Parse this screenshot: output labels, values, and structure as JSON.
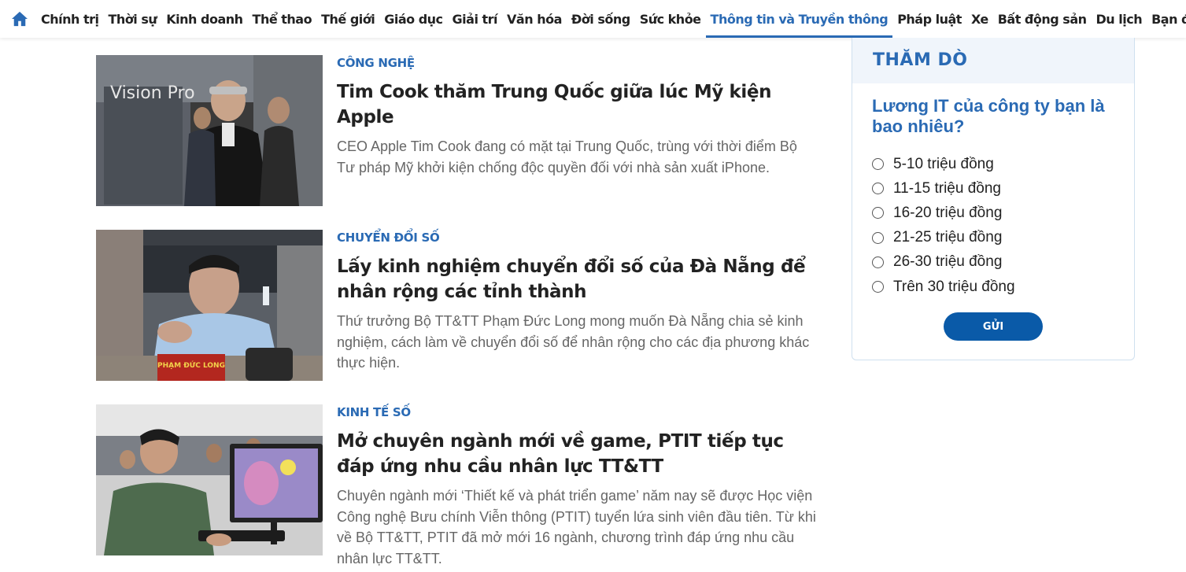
{
  "nav": {
    "home_icon": "home-icon",
    "items": [
      {
        "label": "Chính trị"
      },
      {
        "label": "Thời sự"
      },
      {
        "label": "Kinh doanh"
      },
      {
        "label": "Thể thao"
      },
      {
        "label": "Thế giới"
      },
      {
        "label": "Giáo dục"
      },
      {
        "label": "Giải trí"
      },
      {
        "label": "Văn hóa"
      },
      {
        "label": "Đời sống"
      },
      {
        "label": "Sức khỏe"
      },
      {
        "label": "Thông tin và Truyền thông",
        "active": true
      },
      {
        "label": "Pháp luật"
      },
      {
        "label": "Xe"
      },
      {
        "label": "Bất động sản"
      },
      {
        "label": "Du lịch"
      },
      {
        "label": "Bạn đọc"
      }
    ]
  },
  "articles": [
    {
      "category": "Công nghệ",
      "title": "Tim Cook thăm Trung Quốc giữa lúc Mỹ kiện Apple",
      "description": "CEO Apple Tim Cook đang có mặt tại Trung Quốc, trùng với thời điểm Bộ Tư pháp Mỹ khởi kiện chống độc quyền đối với nhà sản xuất iPhone.",
      "image_text": "Vision Pro"
    },
    {
      "category": "Chuyển đổi số",
      "title": "Lấy kinh nghiệm chuyển đổi số của Đà Nẵng để nhân rộng các tỉnh thành",
      "description": "Thứ trưởng Bộ TT&TT Phạm Đức Long mong muốn Đà Nẵng chia sẻ kinh nghiệm, cách làm về chuyển đổi số để nhân rộng cho các địa phương khác thực hiện.",
      "image_text": "PHẠM ĐỨC LONG"
    },
    {
      "category": "Kinh tế số",
      "title": "Mở chuyên ngành mới về game, PTIT tiếp tục đáp ứng nhu cầu nhân lực TT&TT",
      "description": "Chuyên ngành mới ‘Thiết kế và phát triển game’ năm nay sẽ được Học viện Công nghệ Bưu chính Viễn thông (PTIT) tuyển lứa sinh viên đầu tiên. Từ khi về Bộ TT&TT, PTIT đã mở mới 16 ngành, chương trình đáp ứng nhu cầu nhân lực TT&TT."
    }
  ],
  "poll": {
    "heading": "THĂM DÒ",
    "question": "Lương IT của công ty bạn là bao nhiêu?",
    "options": [
      "5-10 triệu đồng",
      "11-15 triệu đồng",
      "16-20 triệu đồng",
      "21-25 triệu đồng",
      "26-30 triệu đồng",
      "Trên 30 triệu đồng"
    ],
    "submit_label": "GỬI"
  },
  "colors": {
    "accent": "#2a6ab4",
    "button": "#0a5aa8"
  }
}
